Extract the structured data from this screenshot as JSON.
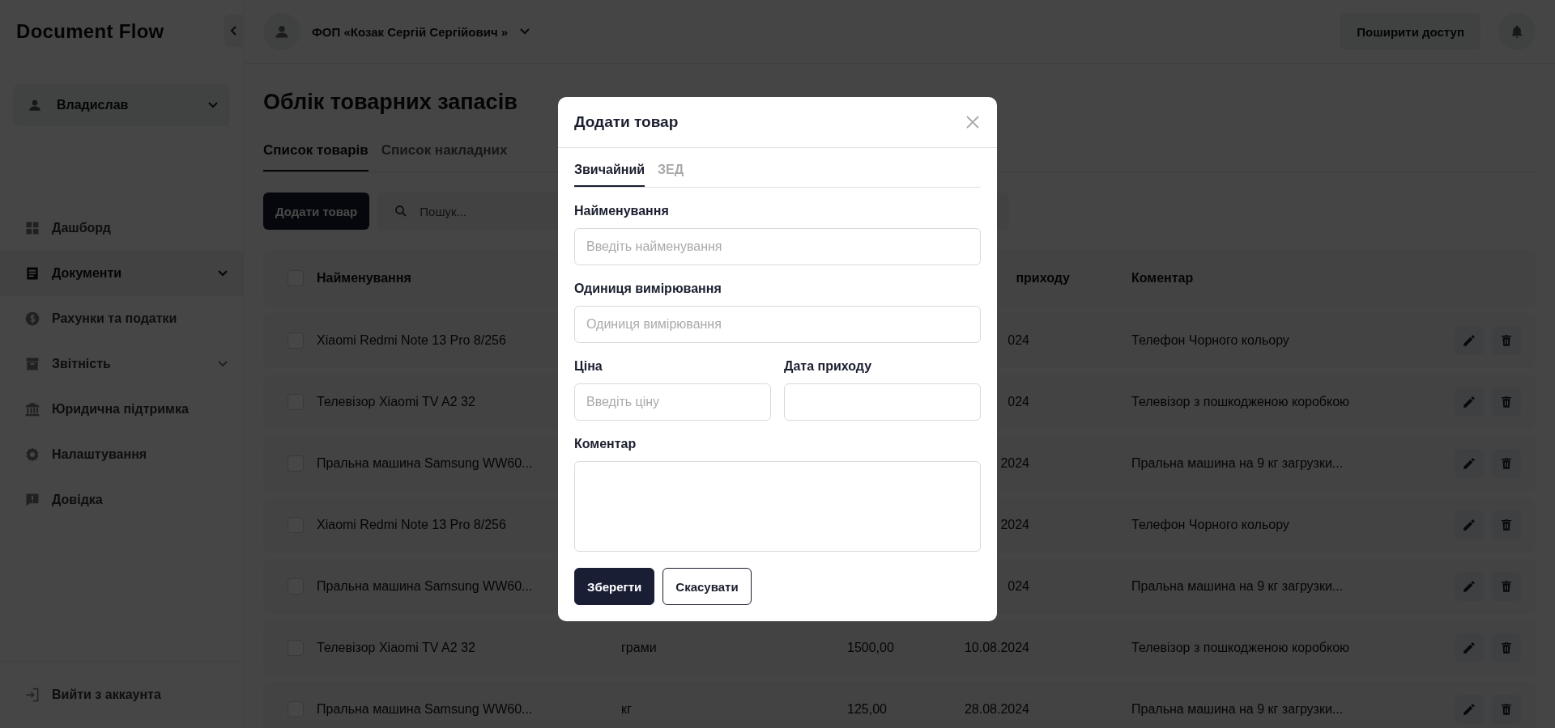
{
  "sidebar": {
    "logo": "Document Flow",
    "user": {
      "name": "Владислав"
    },
    "items": [
      {
        "label": "Дашборд",
        "kind": "dashboard",
        "selected": false,
        "submenu": false
      },
      {
        "label": "Документи",
        "kind": "document",
        "selected": true,
        "submenu": true
      },
      {
        "label": "Рахунки та податки",
        "kind": "money",
        "selected": false,
        "submenu": false
      },
      {
        "label": "Звітність",
        "kind": "archive",
        "selected": false,
        "submenu": true
      },
      {
        "label": "Юридична підтримка",
        "kind": "bank",
        "selected": false,
        "submenu": false
      },
      {
        "label": "Налаштування",
        "kind": "settings",
        "selected": false,
        "submenu": false
      },
      {
        "label": "Довідка",
        "kind": "help",
        "selected": false,
        "submenu": false
      }
    ],
    "logout": "Вийти з аккаунта"
  },
  "topbar": {
    "company": "ФОП «Козак Сергій Сергійович »",
    "share_button": "Поширити доступ"
  },
  "page": {
    "title": "Облік товарних запасів",
    "tabs": [
      {
        "label": "Список товарів",
        "selected": true
      },
      {
        "label": "Список накладних",
        "selected": false
      }
    ],
    "add_button": "Додати товар",
    "search": {
      "placeholder": "Пошук..."
    }
  },
  "table": {
    "header_checked": false,
    "columns": [
      "Найменування",
      "",
      "",
      "приходу",
      "Коментар"
    ],
    "rows": [
      {
        "checked": false,
        "cells": [
          "Xiaomi Redmi Note 13 Pro 8/256",
          "",
          "",
          "024",
          "Телефон Чорного кольору"
        ]
      },
      {
        "checked": false,
        "cells": [
          "Телевізор Xiaomi TV A2 32",
          "",
          "",
          "024",
          "Телевізор з пошкодженою коробкою"
        ]
      },
      {
        "checked": false,
        "cells": [
          "Пральна машина Samsung WW60...",
          "",
          "",
          "2024",
          "Пральна машина на 9 кг загрузки..."
        ]
      },
      {
        "checked": false,
        "cells": [
          "Xiaomi Redmi Note 13 Pro 8/256",
          "",
          "",
          "2024",
          "Телефон Чорного кольору"
        ]
      },
      {
        "checked": false,
        "cells": [
          "Пральна машина Samsung WW60...",
          "",
          "",
          "024",
          "Пральна машина на 9 кг загрузки..."
        ]
      },
      {
        "checked": false,
        "cells": [
          "Телевізор Xiaomi TV A2 32",
          "грами",
          "1500,00",
          "10.08.2024",
          "Телевізор з пошкодженою коробкою"
        ]
      },
      {
        "checked": false,
        "cells": [
          "Пральна машина Samsung WW60...",
          "кг",
          "125,00",
          "28.08.2024",
          "Пральна машина на 9 кг загрузки..."
        ]
      }
    ]
  },
  "modal": {
    "title": "Додати товар",
    "tabs": [
      {
        "label": "Звичайний",
        "selected": true
      },
      {
        "label": "ЗЕД",
        "selected": false
      }
    ],
    "field_rows": [
      [
        {
          "label": "Найменування",
          "kind": "text",
          "placeholder": "Введіть найменування"
        }
      ],
      [
        {
          "label": "Одиниця вимірювання",
          "kind": "text",
          "placeholder": "Одиниця вимірювання"
        }
      ],
      [
        {
          "label": "Ціна",
          "kind": "text",
          "placeholder": "Введіть ціну"
        },
        {
          "label": "Дата приходу",
          "kind": "text"
        }
      ],
      [
        {
          "label": "Коментар",
          "kind": "textarea"
        }
      ]
    ],
    "buttons": [
      {
        "label": "Зберегти",
        "kind": "primary"
      },
      {
        "label": "Скасувати",
        "kind": "secondary"
      }
    ]
  }
}
